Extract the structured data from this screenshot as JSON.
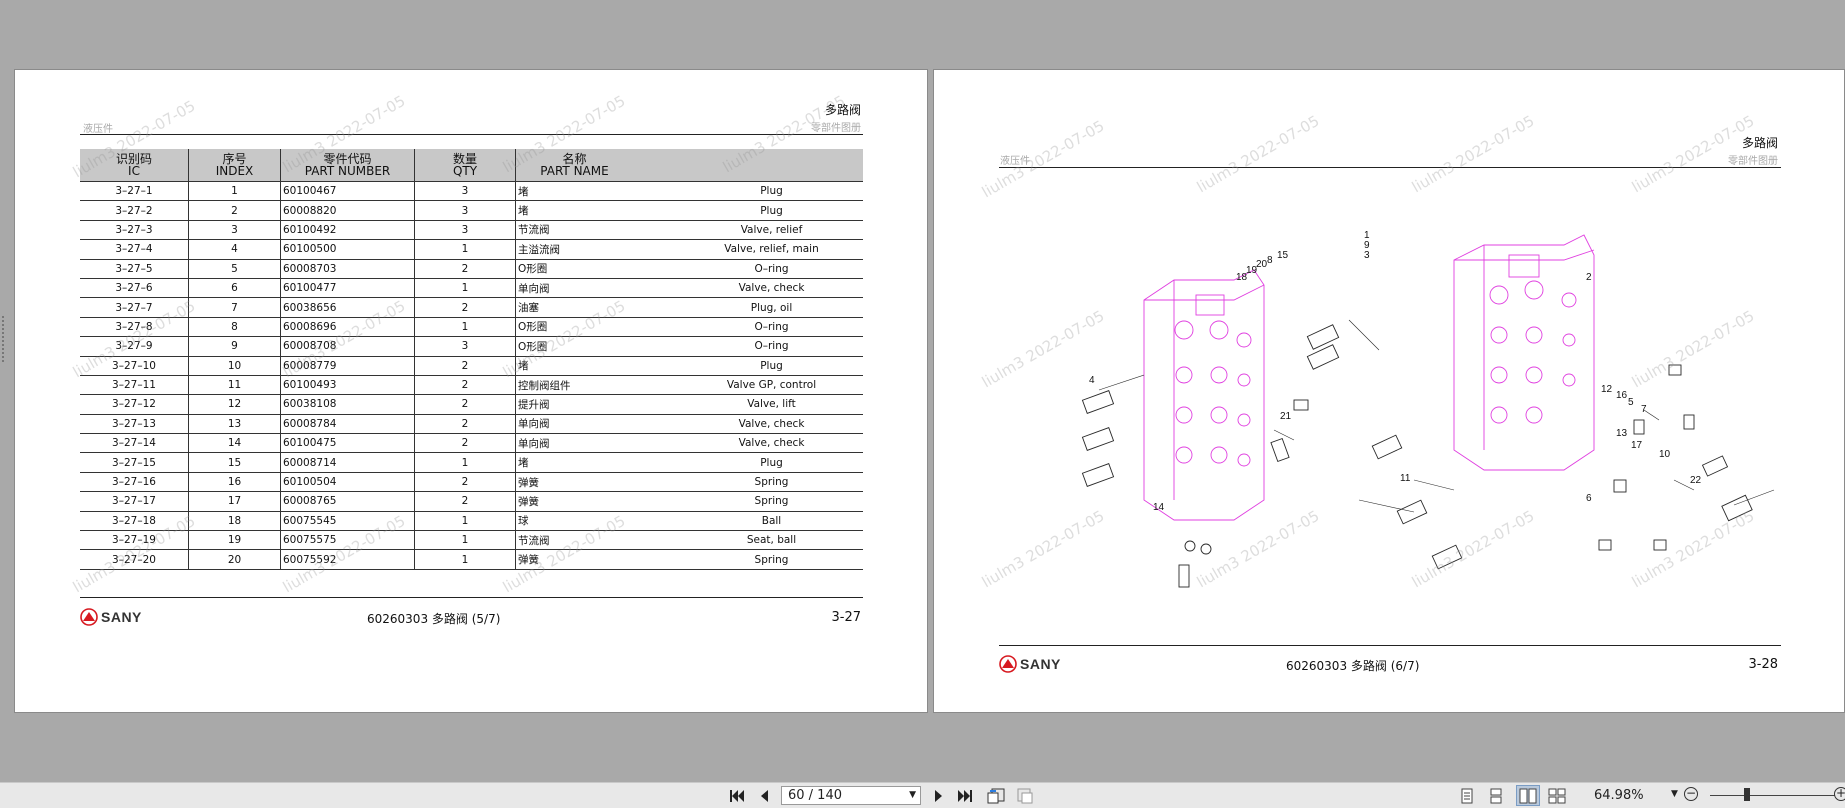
{
  "left_page": {
    "header_title": "多路阀",
    "header_sub": "零部件图册",
    "header_left_sub": "液压件",
    "columns": [
      {
        "cn": "识别码",
        "en": "IC"
      },
      {
        "cn": "序号",
        "en": "INDEX"
      },
      {
        "cn": "零件代码",
        "en": "PART NUMBER"
      },
      {
        "cn": "数量",
        "en": "QTY"
      },
      {
        "cn": "名称",
        "en": "PART NAME"
      }
    ],
    "rows": [
      {
        "ic": "3–27–1",
        "index": "1",
        "part": "60100467",
        "qty": "3",
        "cn": "堵",
        "en": "Plug"
      },
      {
        "ic": "3–27–2",
        "index": "2",
        "part": "60008820",
        "qty": "3",
        "cn": "堵",
        "en": "Plug"
      },
      {
        "ic": "3–27–3",
        "index": "3",
        "part": "60100492",
        "qty": "3",
        "cn": "节流阀",
        "en": "Valve, relief"
      },
      {
        "ic": "3–27–4",
        "index": "4",
        "part": "60100500",
        "qty": "1",
        "cn": "主溢流阀",
        "en": "Valve, relief, main"
      },
      {
        "ic": "3–27–5",
        "index": "5",
        "part": "60008703",
        "qty": "2",
        "cn": "O形圈",
        "en": "O–ring"
      },
      {
        "ic": "3–27–6",
        "index": "6",
        "part": "60100477",
        "qty": "1",
        "cn": "单向阀",
        "en": "Valve, check"
      },
      {
        "ic": "3–27–7",
        "index": "7",
        "part": "60038656",
        "qty": "2",
        "cn": "油塞",
        "en": "Plug, oil"
      },
      {
        "ic": "3–27–8",
        "index": "8",
        "part": "60008696",
        "qty": "1",
        "cn": "O形圈",
        "en": "O–ring"
      },
      {
        "ic": "3–27–9",
        "index": "9",
        "part": "60008708",
        "qty": "3",
        "cn": "O形圈",
        "en": "O–ring"
      },
      {
        "ic": "3–27–10",
        "index": "10",
        "part": "60008779",
        "qty": "2",
        "cn": "堵",
        "en": "Plug"
      },
      {
        "ic": "3–27–11",
        "index": "11",
        "part": "60100493",
        "qty": "2",
        "cn": "控制阀组件",
        "en": "Valve GP, control"
      },
      {
        "ic": "3–27–12",
        "index": "12",
        "part": "60038108",
        "qty": "2",
        "cn": "提升阀",
        "en": "Valve, lift"
      },
      {
        "ic": "3–27–13",
        "index": "13",
        "part": "60008784",
        "qty": "2",
        "cn": "单向阀",
        "en": "Valve, check"
      },
      {
        "ic": "3–27–14",
        "index": "14",
        "part": "60100475",
        "qty": "2",
        "cn": "单向阀",
        "en": "Valve, check"
      },
      {
        "ic": "3–27–15",
        "index": "15",
        "part": "60008714",
        "qty": "1",
        "cn": "堵",
        "en": "Plug"
      },
      {
        "ic": "3–27–16",
        "index": "16",
        "part": "60100504",
        "qty": "2",
        "cn": "弹簧",
        "en": "Spring"
      },
      {
        "ic": "3–27–17",
        "index": "17",
        "part": "60008765",
        "qty": "2",
        "cn": "弹簧",
        "en": "Spring"
      },
      {
        "ic": "3–27–18",
        "index": "18",
        "part": "60075545",
        "qty": "1",
        "cn": "球",
        "en": "Ball"
      },
      {
        "ic": "3–27–19",
        "index": "19",
        "part": "60075575",
        "qty": "1",
        "cn": "节流阀",
        "en": "Seat, ball"
      },
      {
        "ic": "3–27–20",
        "index": "20",
        "part": "60075592",
        "qty": "1",
        "cn": "弹簧",
        "en": "Spring"
      }
    ],
    "logo_text": "SANY",
    "footer_center": "60260303 多路阀 (5/7)",
    "footer_page": "3-27"
  },
  "right_page": {
    "header_title": "多路阀",
    "header_sub": "零部件图册",
    "header_left_sub": "液压件",
    "callouts": [
      "1",
      "9",
      "3",
      "2",
      "4",
      "18",
      "19",
      "20",
      "8",
      "15",
      "21",
      "14",
      "12",
      "16",
      "5",
      "7",
      "13",
      "17",
      "10",
      "11",
      "6",
      "22"
    ],
    "logo_text": "SANY",
    "footer_center": "60260303 多路阀 (6/7)",
    "footer_page": "3-28"
  },
  "watermark": "liulm3 2022-07-05",
  "toolbar": {
    "page_value": "60 / 140",
    "zoom_value": "64.98%"
  },
  "colors": {
    "background": "#a9a9a9",
    "table_header": "#c8c8c8",
    "logo_red": "#d71920",
    "diagram_magenta": "#e040e0"
  }
}
